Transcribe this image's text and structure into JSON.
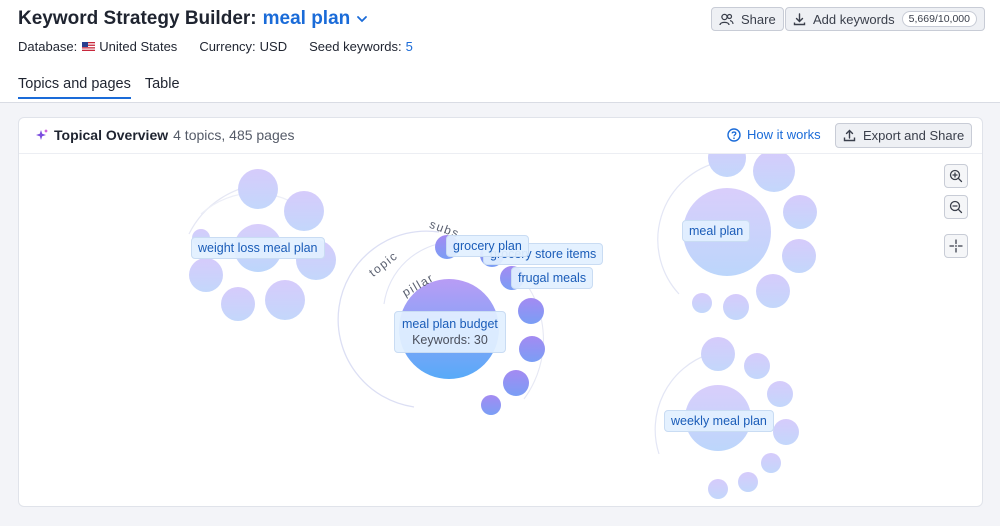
{
  "header": {
    "title": "Keyword Strategy Builder:",
    "title_link": "meal plan",
    "share_label": "Share",
    "add_keywords_label": "Add keywords",
    "keywords_usage": "5,669/10,000"
  },
  "meta": {
    "database_label": "Database:",
    "database_value": "United States",
    "currency_label": "Currency:",
    "currency_value": "USD",
    "seed_label": "Seed keywords:",
    "seed_value": "5"
  },
  "tabs": [
    {
      "label": "Topics and pages",
      "active": true
    },
    {
      "label": "Table",
      "active": false
    }
  ],
  "overview": {
    "title": "Topical Overview",
    "subtitle": "4 topics, 485 pages",
    "how_label": "How it works",
    "export_label": "Export and Share"
  },
  "map": {
    "arc_words": {
      "subs": "subs",
      "topic": "topic",
      "pillar": "pillar"
    },
    "labels": {
      "weight_loss": "weight loss meal plan",
      "grocery_plan": "grocery plan",
      "grocery_store": "grocery store items",
      "frugal": "frugal meals",
      "pillar_name": "meal plan budget",
      "pillar_keywords": "Keywords: 30",
      "meal_plan": "meal plan",
      "weekly": "weekly meal plan"
    }
  },
  "colors": {
    "accent": "#1a6bd8",
    "bubble_light": "#c8d8fb",
    "bubble_purple": "#b69bf5",
    "bubble_blue": "#5aa8f8"
  }
}
